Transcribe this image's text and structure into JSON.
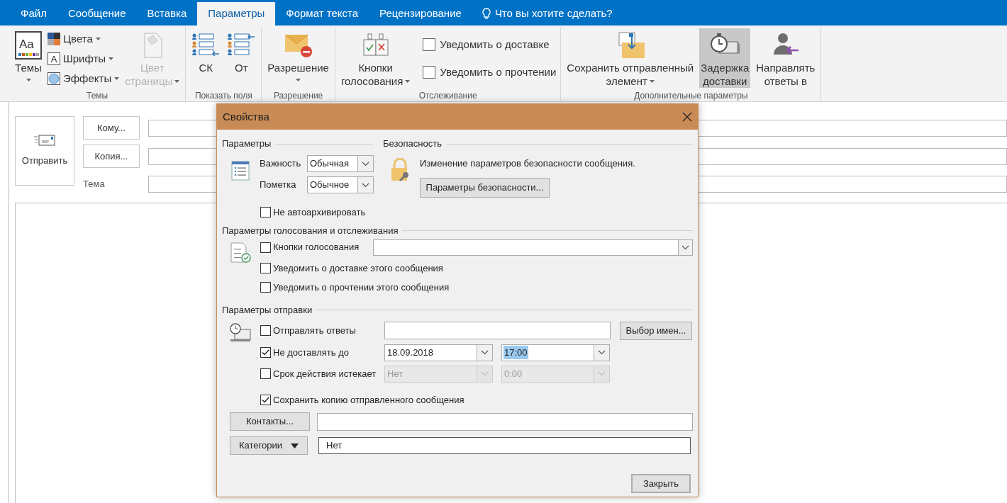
{
  "ribbon": {
    "tabs": [
      {
        "label": "Файл",
        "selected": false
      },
      {
        "label": "Сообщение",
        "selected": false
      },
      {
        "label": "Вставка",
        "selected": false
      },
      {
        "label": "Параметры",
        "selected": true
      },
      {
        "label": "Формат текста",
        "selected": false
      },
      {
        "label": "Рецензирование",
        "selected": false
      }
    ],
    "tell_me": "Что вы хотите сделать?",
    "groups": [
      {
        "label": "Темы",
        "items": [
          {
            "kind": "large",
            "label": [
              "Темы"
            ],
            "dropdown": true,
            "disabled": false,
            "highlighted": false,
            "icon_text": "Aa"
          },
          {
            "kind": "stack",
            "items": [
              {
                "label": "Цвета",
                "dropdown": true
              },
              {
                "label": "Шрифты",
                "dropdown": true,
                "icon_text": "A"
              },
              {
                "label": "Эффекты",
                "dropdown": true
              }
            ]
          },
          {
            "kind": "large",
            "label": [
              "Цвет",
              "страницы"
            ],
            "dropdown": true,
            "disabled": true,
            "highlighted": false
          }
        ]
      },
      {
        "label": "Показать поля",
        "items": [
          {
            "kind": "large",
            "label": [
              "СК"
            ],
            "dropdown": false,
            "disabled": false,
            "highlighted": false
          },
          {
            "kind": "large",
            "label": [
              "От"
            ],
            "dropdown": false,
            "disabled": false,
            "highlighted": false
          }
        ]
      },
      {
        "label": "Разрешение",
        "items": [
          {
            "kind": "large",
            "label": [
              "Разрешение"
            ],
            "dropdown": true,
            "disabled": false,
            "highlighted": false
          }
        ]
      },
      {
        "label": "Отслеживание",
        "items": [
          {
            "kind": "large",
            "label": [
              "Кнопки",
              "голосования"
            ],
            "dropdown": true,
            "disabled": false,
            "highlighted": false
          },
          {
            "kind": "checks",
            "items": [
              {
                "label": "Уведомить о доставке",
                "checked": false
              },
              {
                "label": "Уведомить о прочтении",
                "checked": false
              }
            ]
          }
        ]
      },
      {
        "label": "Дополнительные параметры",
        "items": [
          {
            "kind": "large",
            "label": [
              "Сохранить отправленный",
              "элемент"
            ],
            "dropdown": true,
            "disabled": false,
            "highlighted": false
          },
          {
            "kind": "large",
            "label": [
              "Задержка",
              "доставки"
            ],
            "dropdown": false,
            "disabled": false,
            "highlighted": true
          },
          {
            "kind": "large",
            "label": [
              "Направлять",
              "ответы в"
            ],
            "dropdown": false,
            "disabled": false,
            "highlighted": false
          }
        ]
      }
    ]
  },
  "compose": {
    "send": "Отправить",
    "to": "Кому...",
    "cc": "Копия...",
    "subject_label": "Тема"
  },
  "dialog": {
    "title": "Свойства",
    "settings": {
      "heading": "Параметры",
      "importance_label": "Важность",
      "importance": "Обычная",
      "sensitivity_label": "Пометка",
      "sensitivity": "Обычное",
      "no_autoarchive": {
        "label": "Не автоархивировать",
        "checked": false
      }
    },
    "security": {
      "heading": "Безопасность",
      "text": "Изменение параметров безопасности сообщения.",
      "button": "Параметры безопасности..."
    },
    "voting": {
      "heading": "Параметры голосования и отслеживания",
      "voting_buttons": {
        "label": "Кнопки голосования",
        "checked": false
      },
      "checks": [
        {
          "label": "Уведомить о доставке этого сообщения",
          "checked": false
        },
        {
          "label": "Уведомить о прочтении этого сообщения",
          "checked": false
        }
      ]
    },
    "delivery": {
      "heading": "Параметры отправки",
      "replies": {
        "label": "Отправлять ответы",
        "checked": false,
        "button": "Выбор имен..."
      },
      "delay": {
        "label": "Не доставлять до",
        "checked": true,
        "date": {
          "value": "18.09.2018",
          "disabled": false
        },
        "time": {
          "value": "17:00",
          "disabled": false,
          "highlighted": true
        }
      },
      "expires": {
        "label": "Срок действия истекает",
        "checked": false,
        "date": {
          "value": "Нет",
          "disabled": true
        },
        "time": {
          "value": "0:00",
          "disabled": true,
          "highlighted": false
        }
      },
      "save_copy": {
        "label": "Сохранить копию отправленного сообщения",
        "checked": true
      }
    },
    "contacts_button": "Контакты...",
    "categories_button": "Категории",
    "categories_value": "Нет",
    "close_button": "Закрыть"
  }
}
